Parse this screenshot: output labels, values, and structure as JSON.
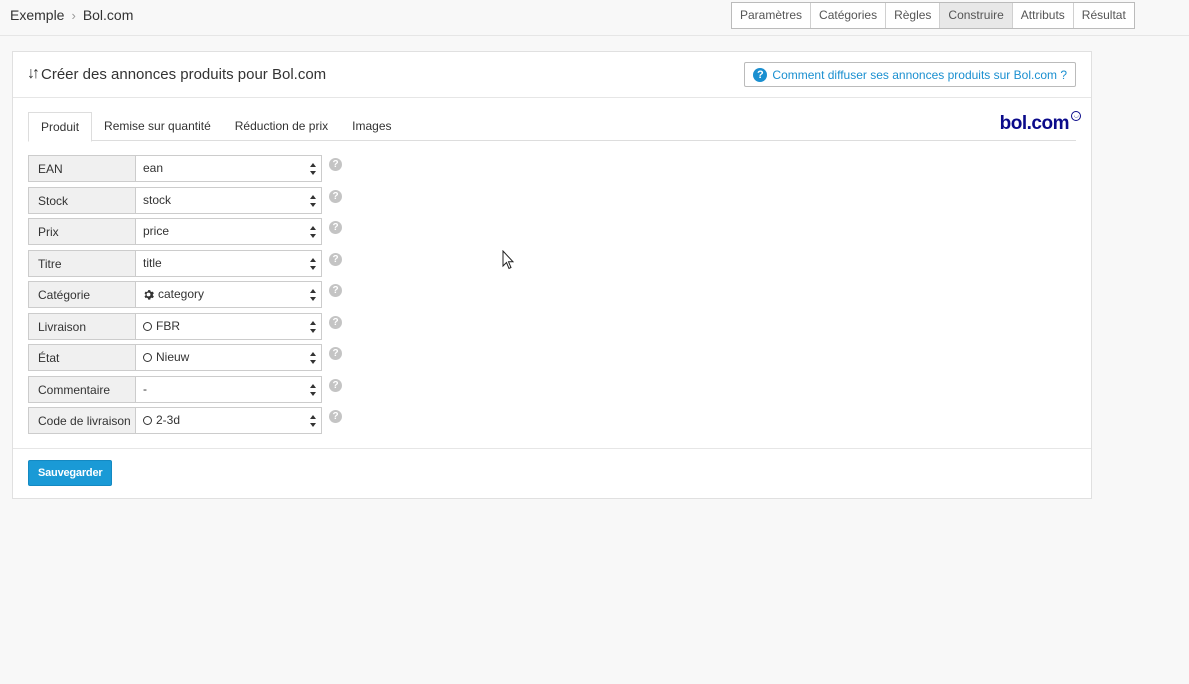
{
  "breadcrumb": {
    "root": "Exemple",
    "current": "Bol.com"
  },
  "steps": [
    "Paramètres",
    "Catégories",
    "Règles",
    "Construire",
    "Attributs",
    "Résultat"
  ],
  "panel": {
    "title": "Créer des annonces produits pour Bol.com",
    "help_link": "Comment diffuser ses annonces produits sur Bol.com ?"
  },
  "tabs": [
    "Produit",
    "Remise sur quantité",
    "Réduction de prix",
    "Images"
  ],
  "brand": "bol.com",
  "fields": [
    {
      "label": "EAN",
      "value": "ean",
      "icon": ""
    },
    {
      "label": "Stock",
      "value": "stock",
      "icon": ""
    },
    {
      "label": "Prix",
      "value": "price",
      "icon": ""
    },
    {
      "label": "Titre",
      "value": "title",
      "icon": ""
    },
    {
      "label": "Catégorie",
      "value": "category",
      "icon": "gear-icon"
    },
    {
      "label": "Livraison",
      "value": "FBR",
      "icon": "circle-icon"
    },
    {
      "label": "État",
      "value": "Nieuw",
      "icon": "circle-icon"
    },
    {
      "label": "Commentaire",
      "value": "-",
      "icon": ""
    },
    {
      "label": "Code de livraison",
      "value": "2-3d",
      "icon": "circle-icon"
    }
  ],
  "save_label": "Sauvegarder",
  "colors": {
    "accent": "#1a9ad6",
    "link": "#1a8fd0",
    "brand": "#0a0a8a"
  }
}
